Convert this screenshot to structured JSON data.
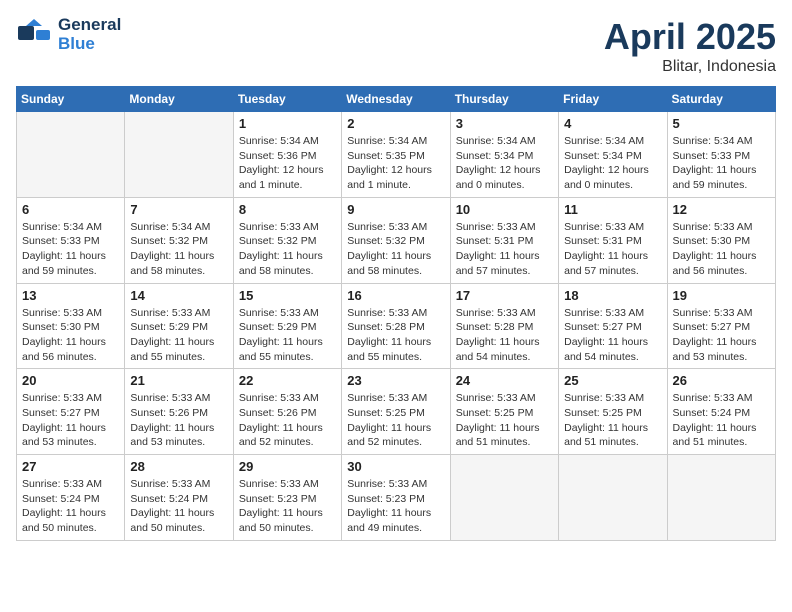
{
  "header": {
    "logo_general": "General",
    "logo_blue": "Blue",
    "title": "April 2025",
    "location": "Blitar, Indonesia"
  },
  "weekdays": [
    "Sunday",
    "Monday",
    "Tuesday",
    "Wednesday",
    "Thursday",
    "Friday",
    "Saturday"
  ],
  "weeks": [
    [
      {
        "day": "",
        "info": ""
      },
      {
        "day": "",
        "info": ""
      },
      {
        "day": "1",
        "info": "Sunrise: 5:34 AM\nSunset: 5:36 PM\nDaylight: 12 hours\nand 1 minute."
      },
      {
        "day": "2",
        "info": "Sunrise: 5:34 AM\nSunset: 5:35 PM\nDaylight: 12 hours\nand 1 minute."
      },
      {
        "day": "3",
        "info": "Sunrise: 5:34 AM\nSunset: 5:34 PM\nDaylight: 12 hours\nand 0 minutes."
      },
      {
        "day": "4",
        "info": "Sunrise: 5:34 AM\nSunset: 5:34 PM\nDaylight: 12 hours\nand 0 minutes."
      },
      {
        "day": "5",
        "info": "Sunrise: 5:34 AM\nSunset: 5:33 PM\nDaylight: 11 hours\nand 59 minutes."
      }
    ],
    [
      {
        "day": "6",
        "info": "Sunrise: 5:34 AM\nSunset: 5:33 PM\nDaylight: 11 hours\nand 59 minutes."
      },
      {
        "day": "7",
        "info": "Sunrise: 5:34 AM\nSunset: 5:32 PM\nDaylight: 11 hours\nand 58 minutes."
      },
      {
        "day": "8",
        "info": "Sunrise: 5:33 AM\nSunset: 5:32 PM\nDaylight: 11 hours\nand 58 minutes."
      },
      {
        "day": "9",
        "info": "Sunrise: 5:33 AM\nSunset: 5:32 PM\nDaylight: 11 hours\nand 58 minutes."
      },
      {
        "day": "10",
        "info": "Sunrise: 5:33 AM\nSunset: 5:31 PM\nDaylight: 11 hours\nand 57 minutes."
      },
      {
        "day": "11",
        "info": "Sunrise: 5:33 AM\nSunset: 5:31 PM\nDaylight: 11 hours\nand 57 minutes."
      },
      {
        "day": "12",
        "info": "Sunrise: 5:33 AM\nSunset: 5:30 PM\nDaylight: 11 hours\nand 56 minutes."
      }
    ],
    [
      {
        "day": "13",
        "info": "Sunrise: 5:33 AM\nSunset: 5:30 PM\nDaylight: 11 hours\nand 56 minutes."
      },
      {
        "day": "14",
        "info": "Sunrise: 5:33 AM\nSunset: 5:29 PM\nDaylight: 11 hours\nand 55 minutes."
      },
      {
        "day": "15",
        "info": "Sunrise: 5:33 AM\nSunset: 5:29 PM\nDaylight: 11 hours\nand 55 minutes."
      },
      {
        "day": "16",
        "info": "Sunrise: 5:33 AM\nSunset: 5:28 PM\nDaylight: 11 hours\nand 55 minutes."
      },
      {
        "day": "17",
        "info": "Sunrise: 5:33 AM\nSunset: 5:28 PM\nDaylight: 11 hours\nand 54 minutes."
      },
      {
        "day": "18",
        "info": "Sunrise: 5:33 AM\nSunset: 5:27 PM\nDaylight: 11 hours\nand 54 minutes."
      },
      {
        "day": "19",
        "info": "Sunrise: 5:33 AM\nSunset: 5:27 PM\nDaylight: 11 hours\nand 53 minutes."
      }
    ],
    [
      {
        "day": "20",
        "info": "Sunrise: 5:33 AM\nSunset: 5:27 PM\nDaylight: 11 hours\nand 53 minutes."
      },
      {
        "day": "21",
        "info": "Sunrise: 5:33 AM\nSunset: 5:26 PM\nDaylight: 11 hours\nand 53 minutes."
      },
      {
        "day": "22",
        "info": "Sunrise: 5:33 AM\nSunset: 5:26 PM\nDaylight: 11 hours\nand 52 minutes."
      },
      {
        "day": "23",
        "info": "Sunrise: 5:33 AM\nSunset: 5:25 PM\nDaylight: 11 hours\nand 52 minutes."
      },
      {
        "day": "24",
        "info": "Sunrise: 5:33 AM\nSunset: 5:25 PM\nDaylight: 11 hours\nand 51 minutes."
      },
      {
        "day": "25",
        "info": "Sunrise: 5:33 AM\nSunset: 5:25 PM\nDaylight: 11 hours\nand 51 minutes."
      },
      {
        "day": "26",
        "info": "Sunrise: 5:33 AM\nSunset: 5:24 PM\nDaylight: 11 hours\nand 51 minutes."
      }
    ],
    [
      {
        "day": "27",
        "info": "Sunrise: 5:33 AM\nSunset: 5:24 PM\nDaylight: 11 hours\nand 50 minutes."
      },
      {
        "day": "28",
        "info": "Sunrise: 5:33 AM\nSunset: 5:24 PM\nDaylight: 11 hours\nand 50 minutes."
      },
      {
        "day": "29",
        "info": "Sunrise: 5:33 AM\nSunset: 5:23 PM\nDaylight: 11 hours\nand 50 minutes."
      },
      {
        "day": "30",
        "info": "Sunrise: 5:33 AM\nSunset: 5:23 PM\nDaylight: 11 hours\nand 49 minutes."
      },
      {
        "day": "",
        "info": ""
      },
      {
        "day": "",
        "info": ""
      },
      {
        "day": "",
        "info": ""
      }
    ]
  ]
}
